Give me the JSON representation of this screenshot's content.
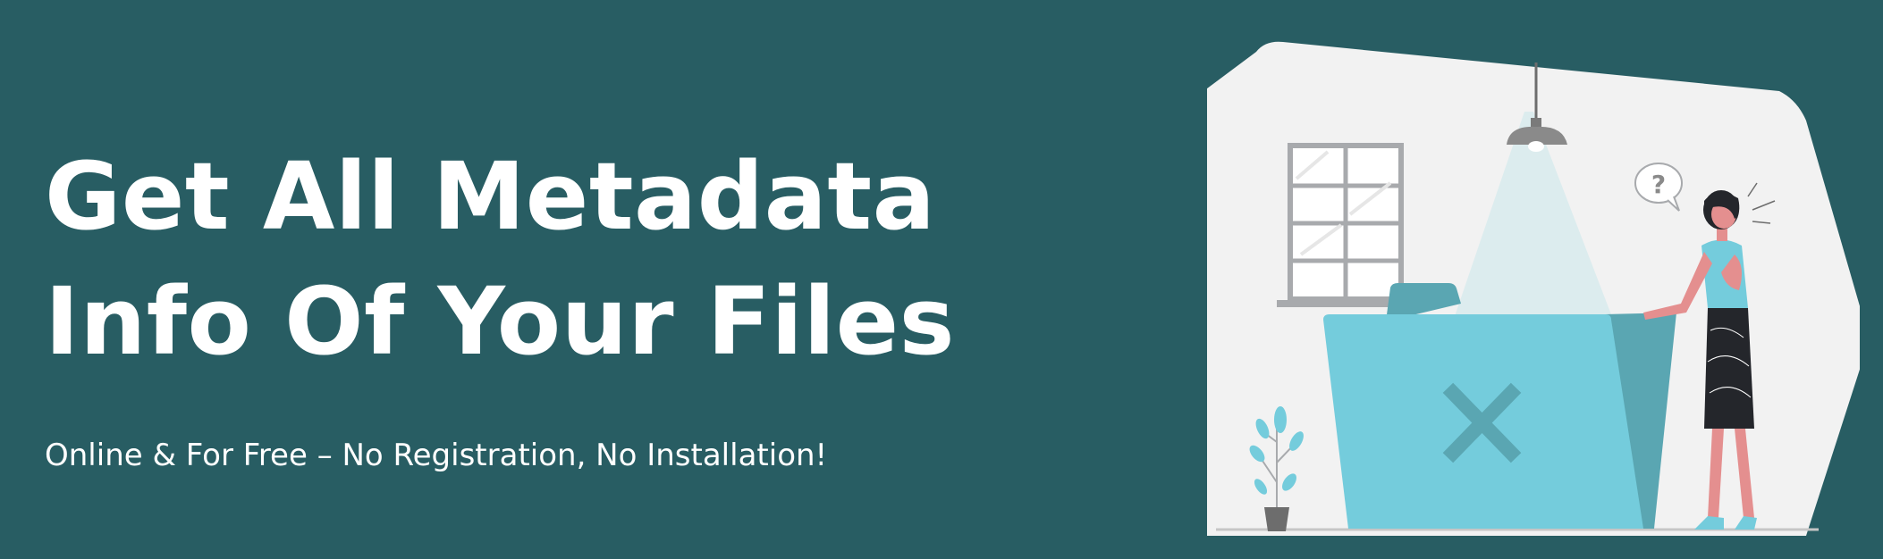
{
  "hero": {
    "headline_line1": "Get All Metadata",
    "headline_line2": "Info Of Your Files",
    "subtitle": "Online & For Free – No Registration, No Installation!"
  },
  "illustration": {
    "question_mark": "?"
  },
  "colors": {
    "background": "#285d63",
    "text": "#ffffff",
    "panel": "#f2f2f2",
    "folder": "#74ccdc",
    "folder_dark": "#5aa6b2",
    "lamp": "#8a8a8a",
    "light_beam": "#dcecee"
  },
  "icons": [
    "lamp-icon",
    "window-icon",
    "folder-icon",
    "close-x-icon",
    "plant-icon",
    "woman-figure-icon",
    "speech-bubble-icon"
  ]
}
